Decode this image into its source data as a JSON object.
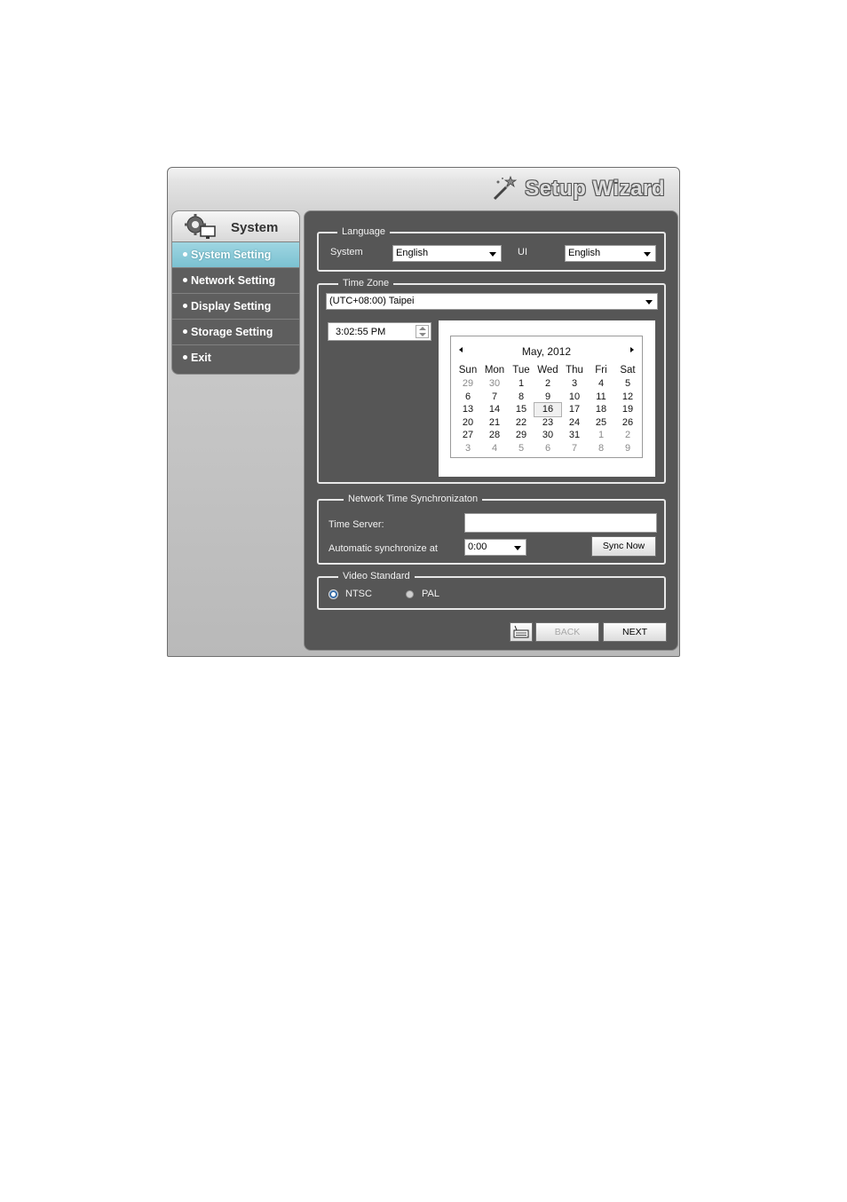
{
  "window": {
    "title": "Setup Wizard"
  },
  "sidebar": {
    "header": "System",
    "items": [
      {
        "label": "System Setting",
        "active": true
      },
      {
        "label": "Network Setting"
      },
      {
        "label": "Display Setting"
      },
      {
        "label": "Storage Setting"
      },
      {
        "label": "Exit"
      }
    ]
  },
  "language": {
    "legend": "Language",
    "system_label": "System",
    "system_value": "English",
    "ui_label": "UI",
    "ui_value": "English"
  },
  "timezone": {
    "legend": "Time Zone",
    "value": "(UTC+08:00) Taipei",
    "time": "3:02:55 PM"
  },
  "calendar": {
    "month": "May, 2012",
    "weekdays": [
      "Sun",
      "Mon",
      "Tue",
      "Wed",
      "Thu",
      "Fri",
      "Sat"
    ],
    "weeks": [
      [
        "29",
        "30",
        "1",
        "2",
        "3",
        "4",
        "5"
      ],
      [
        "6",
        "7",
        "8",
        "9",
        "10",
        "11",
        "12"
      ],
      [
        "13",
        "14",
        "15",
        "16",
        "17",
        "18",
        "19"
      ],
      [
        "20",
        "21",
        "22",
        "23",
        "24",
        "25",
        "26"
      ],
      [
        "27",
        "28",
        "29",
        "30",
        "31",
        "1",
        "2"
      ],
      [
        "3",
        "4",
        "5",
        "6",
        "7",
        "8",
        "9"
      ]
    ],
    "selected": "16"
  },
  "ntp": {
    "legend": "Network Time Synchronizaton",
    "server_label": "Time Server:",
    "server_value": "",
    "auto_label": "Automatic synchronize at",
    "auto_value": "0:00",
    "sync_button": "Sync Now"
  },
  "video": {
    "legend": "Video Standard",
    "options": [
      "NTSC",
      "PAL"
    ],
    "selected": "NTSC"
  },
  "footer": {
    "back": "BACK",
    "next": "NEXT"
  },
  "colors": {
    "panel_bg": "#565656",
    "active_item": "#8ccbd9"
  }
}
